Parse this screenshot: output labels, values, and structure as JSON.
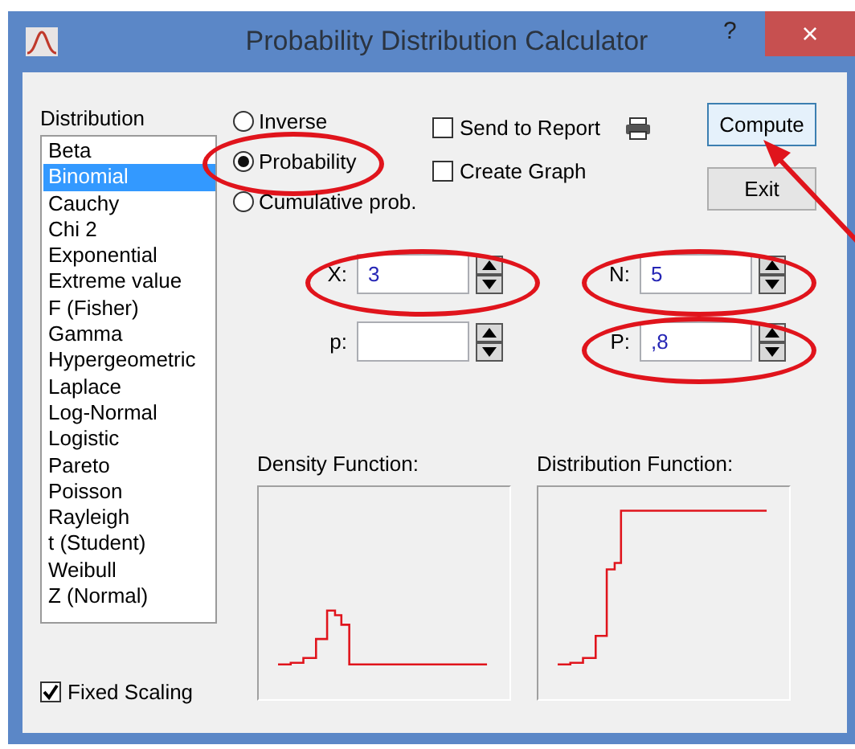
{
  "window": {
    "title": "Probability Distribution Calculator",
    "help": "?",
    "close": "×"
  },
  "distribution": {
    "label": "Distribution",
    "items": [
      {
        "label": "Beta",
        "selected": false
      },
      {
        "label": "Binomial",
        "selected": true
      },
      {
        "label": "Cauchy",
        "selected": false
      },
      {
        "label": "Chi 2",
        "selected": false
      },
      {
        "label": "Exponential",
        "selected": false
      },
      {
        "label": "Extreme value",
        "selected": false
      },
      {
        "label": "F (Fisher)",
        "selected": false
      },
      {
        "label": "Gamma",
        "selected": false
      },
      {
        "label": "Hypergeometric",
        "selected": false
      },
      {
        "label": "Laplace",
        "selected": false
      },
      {
        "label": "Log-Normal",
        "selected": false
      },
      {
        "label": "Logistic",
        "selected": false
      },
      {
        "label": "Pareto",
        "selected": false
      },
      {
        "label": "Poisson",
        "selected": false
      },
      {
        "label": "Rayleigh",
        "selected": false
      },
      {
        "label": "t (Student)",
        "selected": false
      },
      {
        "label": "Weibull",
        "selected": false
      },
      {
        "label": "Z (Normal)",
        "selected": false
      }
    ]
  },
  "modes": [
    {
      "label": "Inverse",
      "selected": false,
      "highlighted": false
    },
    {
      "label": "Probability",
      "selected": true,
      "highlighted": true
    },
    {
      "label": "Cumulative prob.",
      "selected": false,
      "highlighted": false
    }
  ],
  "options": [
    {
      "label": "Send to Report",
      "checked": false,
      "printer": true
    },
    {
      "label": "Create Graph",
      "checked": false,
      "printer": false
    }
  ],
  "buttons": [
    {
      "label": "Compute",
      "focused": true
    },
    {
      "label": "Exit",
      "focused": false
    }
  ],
  "pointer_arrow": true,
  "fields": [
    {
      "label": "X:",
      "value": "3",
      "highlighted": true
    },
    {
      "label": "N:",
      "value": "5",
      "highlighted": true
    },
    {
      "label": "p:",
      "highlighted": false
    },
    {
      "label": "P:",
      "value": ",8",
      "highlighted": true
    }
  ],
  "plots": [
    {
      "kind": "density",
      "title": "Density Function:"
    },
    {
      "kind": "distribution",
      "title": "Distribution Function:"
    }
  ],
  "fixed_scaling": {
    "label": "Fixed Scaling",
    "checked": true
  }
}
